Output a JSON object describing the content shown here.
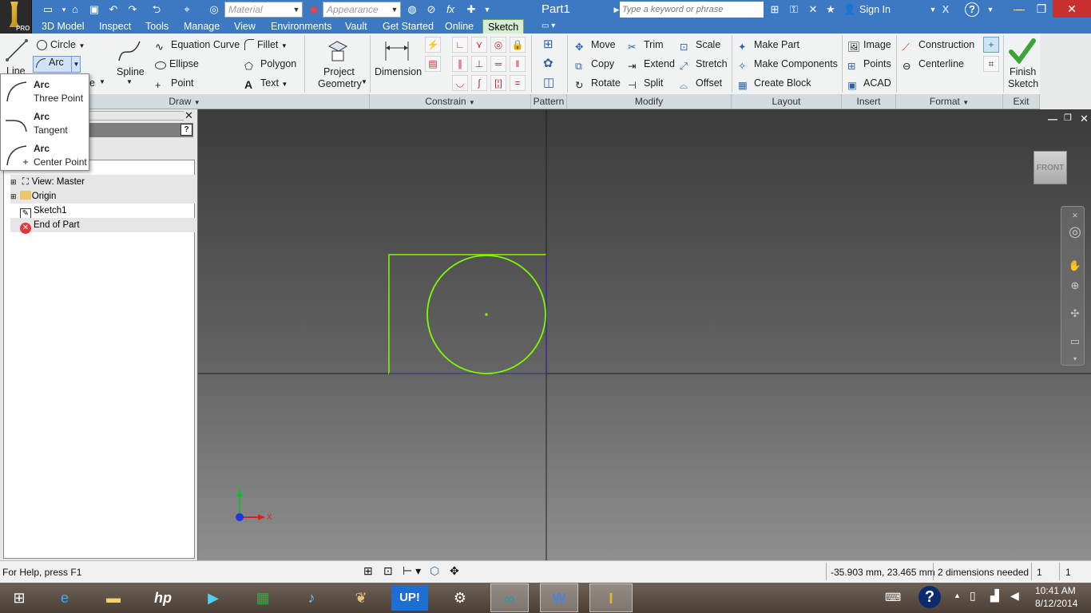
{
  "titlebar": {
    "doc_title": "Part1",
    "material_placeholder": "Material",
    "appearance_placeholder": "Appearance",
    "search_placeholder": "Type a keyword or phrase",
    "sign_in": "Sign In",
    "logo_badge": "PRO"
  },
  "menubar": {
    "items": [
      "3D Model",
      "Inspect",
      "Tools",
      "Manage",
      "View",
      "Environments",
      "Vault",
      "Get Started",
      "Online",
      "Sketch"
    ]
  },
  "ribbon": {
    "draw": {
      "line_label": "Line",
      "circle_label": "Circle",
      "arc_label": "Arc",
      "rectangle_label": "e",
      "spline_label": "Spline",
      "equation_curve_label": "Equation Curve",
      "ellipse_label": "Ellipse",
      "point_label": "Point",
      "fillet_label": "Fillet",
      "polygon_label": "Polygon",
      "text_label": "Text",
      "project_geometry_line1": "Project",
      "project_geometry_line2": "Geometry"
    },
    "constrain": {
      "dimension_label": "Dimension"
    },
    "modify": {
      "move": "Move",
      "copy": "Copy",
      "rotate": "Rotate",
      "trim": "Trim",
      "extend": "Extend",
      "split": "Split",
      "scale": "Scale",
      "stretch": "Stretch",
      "offset": "Offset"
    },
    "layout": {
      "make_part": "Make Part",
      "make_components": "Make Components",
      "create_block": "Create Block"
    },
    "insert": {
      "image": "Image",
      "points": "Points",
      "acad": "ACAD"
    },
    "format": {
      "construction": "Construction",
      "centerline": "Centerline"
    },
    "exit": {
      "finish_line1": "Finish",
      "finish_line2": "Sketch"
    },
    "panels": [
      "Draw",
      "Constrain",
      "Pattern",
      "Modify",
      "Layout",
      "Insert",
      "Format",
      "Exit"
    ]
  },
  "arc_menu": {
    "options": [
      {
        "title": "Arc",
        "subtitle": "Three Point"
      },
      {
        "title": "Arc",
        "subtitle": "Tangent"
      },
      {
        "title": "Arc",
        "subtitle": "Center Point"
      }
    ]
  },
  "browser": {
    "tree": [
      "View: Master",
      "Origin",
      "Sketch1",
      "End of Part"
    ]
  },
  "viewport": {
    "viewcube_label": "FRONT",
    "axis_x": "X",
    "axis_y": "Y",
    "sketch_color": "#7cfc00"
  },
  "statusbar": {
    "help": "For Help, press F1",
    "coords": "-35.903 mm, 23.465 mm",
    "dims_needed": "2 dimensions needed",
    "count1": "1",
    "count2": "1"
  },
  "taskbar": {
    "time": "10:41 AM",
    "date": "8/12/2014",
    "apps": [
      "ie-icon",
      "file-explorer-icon",
      "hp-icon",
      "media-icon",
      "store-icon",
      "itunes-icon",
      "photo-icon",
      "up-icon",
      "steam-icon",
      "arduino-icon",
      "word-icon",
      "inventor-icon"
    ],
    "up_label": "UP!"
  }
}
